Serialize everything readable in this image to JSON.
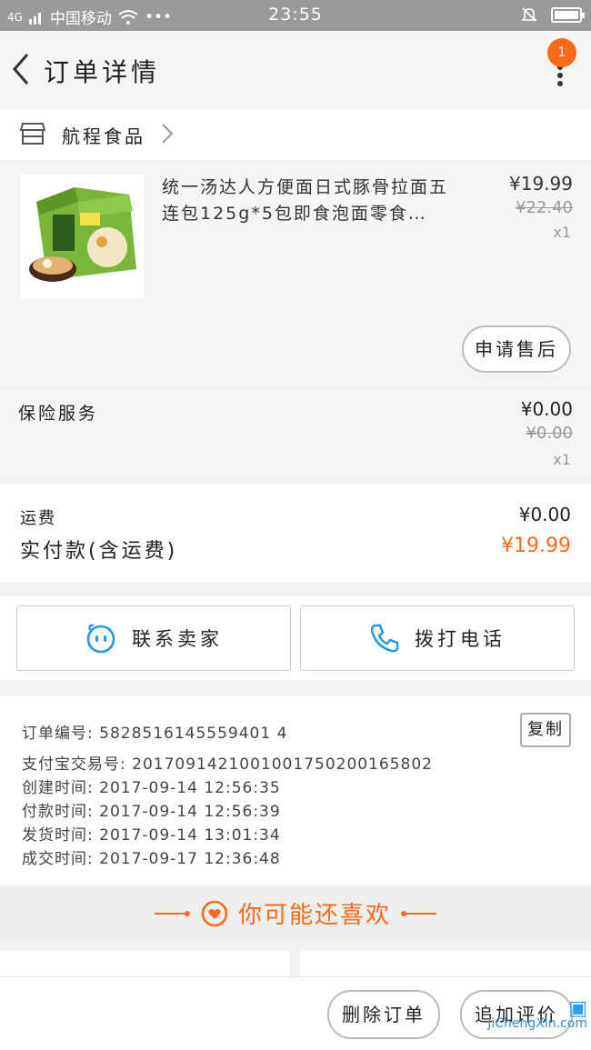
{
  "status_bar": {
    "signal_text": "4G",
    "carrier": "中国移动",
    "dots": "•••",
    "time": "23:55"
  },
  "header": {
    "title": "订单详情",
    "badge_count": "1"
  },
  "shop": {
    "name": "航程食品"
  },
  "product": {
    "title": "统一汤达人方便面日式豚骨拉面五连包125g*5包即食泡面零食…",
    "price": "¥19.99",
    "original_price": "¥22.40",
    "quantity": "x1",
    "after_sale_label": "申请售后"
  },
  "insurance": {
    "label": "保险服务",
    "price": "¥0.00",
    "original_price": "¥0.00",
    "quantity": "x1"
  },
  "totals": {
    "freight_label": "运费",
    "freight_value": "¥0.00",
    "paid_label": "实付款(含运费)",
    "paid_value": "¥19.99"
  },
  "contact": {
    "seller_label": "联系卖家",
    "phone_label": "拨打电话"
  },
  "order_info": {
    "order_no": "订单编号: 5828516145559401 4",
    "copy_label": "复制",
    "alipay_no": "支付宝交易号: 2017091421001001750200165802",
    "created": "创建时间: 2017-09-14 12:56:35",
    "paid": "付款时间: 2017-09-14 12:56:39",
    "shipped": "发货时间: 2017-09-14 13:01:34",
    "completed": "成交时间: 2017-09-17 12:36:48"
  },
  "recommend": {
    "title": "你可能还喜欢"
  },
  "bottom_bar": {
    "delete_label": "删除订单",
    "review_label": "追加评价"
  },
  "watermark": {
    "text": "JiChengXin.com"
  },
  "colors": {
    "accent": "#ff6a1a",
    "status_bar": "#9a9a9a",
    "contact_icon": "#2196f3"
  }
}
